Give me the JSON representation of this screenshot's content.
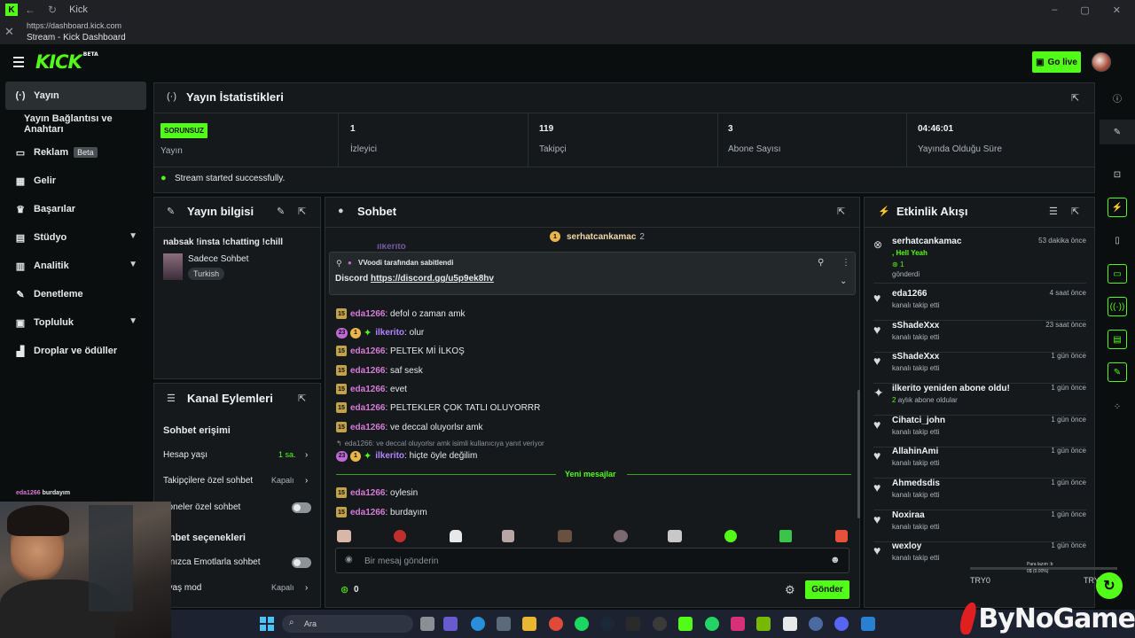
{
  "browser": {
    "tab_title": "Kick",
    "url": "https://dashboard.kick.com",
    "page_title": "Stream - Kick Dashboard"
  },
  "header": {
    "logo": "KICK",
    "logo_badge": "BETA",
    "go_live": "Go live"
  },
  "sidebar": {
    "items": [
      {
        "label": "Yayın",
        "icon": "broadcast-icon"
      },
      {
        "label": "Yayın Bağlantısı ve Anahtarı",
        "icon": ""
      },
      {
        "label": "Reklam",
        "icon": "ad-icon",
        "badge": "Beta"
      },
      {
        "label": "Gelir",
        "icon": "revenue-icon"
      },
      {
        "label": "Başarılar",
        "icon": "trophy-icon"
      },
      {
        "label": "Stüdyo",
        "icon": "studio-icon"
      },
      {
        "label": "Analitik",
        "icon": "chart-icon"
      },
      {
        "label": "Denetleme",
        "icon": "wrench-icon"
      },
      {
        "label": "Topluluk",
        "icon": "community-icon"
      },
      {
        "label": "Droplar ve ödüller",
        "icon": "drops-icon"
      }
    ]
  },
  "stats": {
    "title": "Yayın İstatistikleri",
    "status_badge": "SORUNSUZ",
    "status_label": "Yayın",
    "viewers_value": "1",
    "viewers_label": "İzleyici",
    "followers_value": "119",
    "followers_label": "Takipçi",
    "subs_value": "3",
    "subs_label": "Abone Sayısı",
    "uptime_value": "04:46:01",
    "uptime_label": "Yayında Olduğu Süre",
    "success_msg": "Stream started successfully."
  },
  "stream_info": {
    "title": "Yayın bilgisi",
    "stream_title": "nabsak !insta !chatting !chill",
    "category": "Sadece Sohbet",
    "language": "Turkish"
  },
  "channel_actions": {
    "title": "Kanal Eylemleri",
    "chat_access_heading": "Sohbet erişimi",
    "account_age_label": "Hesap yaşı",
    "account_age_value": "1 sa.",
    "followers_only_label": "Takipçilere özel sohbet",
    "followers_only_value": "Kapalı",
    "subs_only_label": "boneler özel sohbet",
    "chat_options_heading": "ohbet seçenekleri",
    "emote_only_label": "alnızca Emotlarla sohbet",
    "slow_mode_label": "avaş mod",
    "slow_mode_value": "Kapalı"
  },
  "chat": {
    "title": "Sohbet",
    "top_gifter": "serhatcankamac",
    "top_gifter_count": "2",
    "pinned_by": "VVoodi tarafından sabitlendi",
    "pinned_text": "Discord",
    "pinned_link": "https://discord.gg/u5p9ek8hv",
    "messages": [
      {
        "user": "eda1266",
        "text": ": defol o zaman amk",
        "badge": "15"
      },
      {
        "user": "ilkerito",
        "text": ": olur",
        "badge": "23"
      },
      {
        "user": "eda1266",
        "text": ": PELTEK Mİ İLKOŞ",
        "badge": "15"
      },
      {
        "user": "eda1266",
        "text": ": saf sesk",
        "badge": "15"
      },
      {
        "user": "eda1266",
        "text": ": evet",
        "badge": "15"
      },
      {
        "user": "eda1266",
        "text": ": PELTEKLER ÇOK TATLI OLUYORRR",
        "badge": "15"
      },
      {
        "user": "eda1266",
        "text": ": ve deccal oluyorlsr amk",
        "badge": "15"
      }
    ],
    "reply_context": "eda1266: ve deccal oluyorlsr amk isimli kullanıcıya yanıt veriyor",
    "reply_msg": {
      "user": "ilkerito",
      "text": ": hiçte öyle değilim",
      "badge": "23"
    },
    "new_messages": "Yeni mesajlar",
    "new": [
      {
        "user": "eda1266",
        "text": ": oylesin",
        "badge": "15"
      },
      {
        "user": "eda1266",
        "text": ": burdayım",
        "badge": "15"
      }
    ],
    "input_placeholder": "Bir mesaj gönderin",
    "points": "0",
    "send": "Gönder"
  },
  "activity": {
    "title": "Etkinlik Akışı",
    "gift": {
      "user": "serhatcankamac",
      "time": "53 dakika önce",
      "msg": ", Hell Yeah",
      "count": "1",
      "sub": "gönderdi"
    },
    "items": [
      {
        "user": "eda1266",
        "time": "4 saat önce",
        "sub": "kanalı takip etti"
      },
      {
        "user": "sShadeXxx",
        "time": "23 saat önce",
        "sub": "kanalı takip etti"
      },
      {
        "user": "sShadeXxx",
        "time": "1 gün önce",
        "sub": "kanalı takip etti"
      },
      {
        "user": "ilkerito yeniden abone oldu!",
        "time": "1 gün önce",
        "sub": "aylık abone oldular",
        "months": "2"
      },
      {
        "user": "Cihatci_john",
        "time": "1 gün önce",
        "sub": "kanalı takip etti"
      },
      {
        "user": "AllahinAmi",
        "time": "1 gün önce",
        "sub": "kanalı takip etti"
      },
      {
        "user": "Ahmedsdis",
        "time": "1 gün önce",
        "sub": "kanalı takip etti"
      },
      {
        "user": "Noxiraa",
        "time": "1 gün önce",
        "sub": "kanalı takip etti"
      },
      {
        "user": "wexloy",
        "time": "1 gün önce",
        "sub": "kanalı takip etti"
      }
    ]
  },
  "overlay": {
    "cam_name": "eda1266",
    "cam_text": "burdayım",
    "try_left": "TRY0",
    "try_right": "TRY",
    "mini_text_1": "Para lazım :b",
    "mini_text_2": "0$ (0.00%)",
    "watermark": "ByNoGame"
  },
  "taskbar": {
    "search": "Ara"
  },
  "colors": {
    "accent": "#53fc18",
    "panel": "#16191c",
    "bg": "#0b0e0f"
  }
}
